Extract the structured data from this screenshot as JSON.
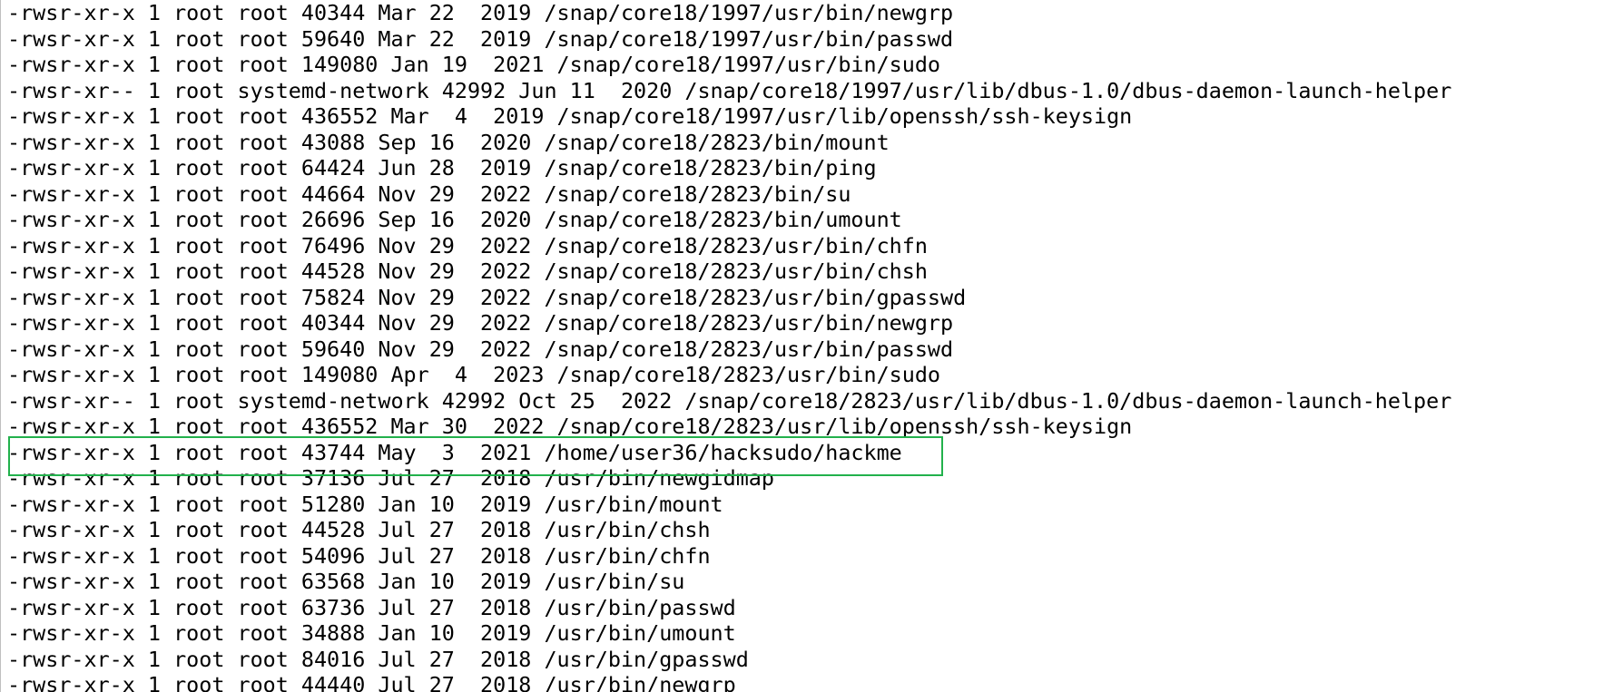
{
  "terminal": {
    "lines": [
      "-rwsr-xr-x 1 root root 40344 Mar 22  2019 /snap/core18/1997/usr/bin/newgrp",
      "-rwsr-xr-x 1 root root 59640 Mar 22  2019 /snap/core18/1997/usr/bin/passwd",
      "-rwsr-xr-x 1 root root 149080 Jan 19  2021 /snap/core18/1997/usr/bin/sudo",
      "-rwsr-xr-- 1 root systemd-network 42992 Jun 11  2020 /snap/core18/1997/usr/lib/dbus-1.0/dbus-daemon-launch-helper",
      "-rwsr-xr-x 1 root root 436552 Mar  4  2019 /snap/core18/1997/usr/lib/openssh/ssh-keysign",
      "-rwsr-xr-x 1 root root 43088 Sep 16  2020 /snap/core18/2823/bin/mount",
      "-rwsr-xr-x 1 root root 64424 Jun 28  2019 /snap/core18/2823/bin/ping",
      "-rwsr-xr-x 1 root root 44664 Nov 29  2022 /snap/core18/2823/bin/su",
      "-rwsr-xr-x 1 root root 26696 Sep 16  2020 /snap/core18/2823/bin/umount",
      "-rwsr-xr-x 1 root root 76496 Nov 29  2022 /snap/core18/2823/usr/bin/chfn",
      "-rwsr-xr-x 1 root root 44528 Nov 29  2022 /snap/core18/2823/usr/bin/chsh",
      "-rwsr-xr-x 1 root root 75824 Nov 29  2022 /snap/core18/2823/usr/bin/gpasswd",
      "-rwsr-xr-x 1 root root 40344 Nov 29  2022 /snap/core18/2823/usr/bin/newgrp",
      "-rwsr-xr-x 1 root root 59640 Nov 29  2022 /snap/core18/2823/usr/bin/passwd",
      "-rwsr-xr-x 1 root root 149080 Apr  4  2023 /snap/core18/2823/usr/bin/sudo",
      "-rwsr-xr-- 1 root systemd-network 42992 Oct 25  2022 /snap/core18/2823/usr/lib/dbus-1.0/dbus-daemon-launch-helper",
      "-rwsr-xr-x 1 root root 436552 Mar 30  2022 /snap/core18/2823/usr/lib/openssh/ssh-keysign",
      "-rwsr-xr-x 1 root root 43744 May  3  2021 /home/user36/hacksudo/hackme",
      "-rwsr-xr-x 1 root root 37136 Jul 27  2018 /usr/bin/newgidmap",
      "-rwsr-xr-x 1 root root 51280 Jan 10  2019 /usr/bin/mount",
      "-rwsr-xr-x 1 root root 44528 Jul 27  2018 /usr/bin/chsh",
      "-rwsr-xr-x 1 root root 54096 Jul 27  2018 /usr/bin/chfn",
      "-rwsr-xr-x 1 root root 63568 Jan 10  2019 /usr/bin/su",
      "-rwsr-xr-x 1 root root 63736 Jul 27  2018 /usr/bin/passwd",
      "-rwsr-xr-x 1 root root 34888 Jan 10  2019 /usr/bin/umount",
      "-rwsr-xr-x 1 root root 84016 Jul 27  2018 /usr/bin/gpasswd",
      "-rwsr-xr-x 1 root root 44440 Jul 27  2018 /usr/bin/newgrp"
    ],
    "highlight_color": "#22b14c"
  }
}
